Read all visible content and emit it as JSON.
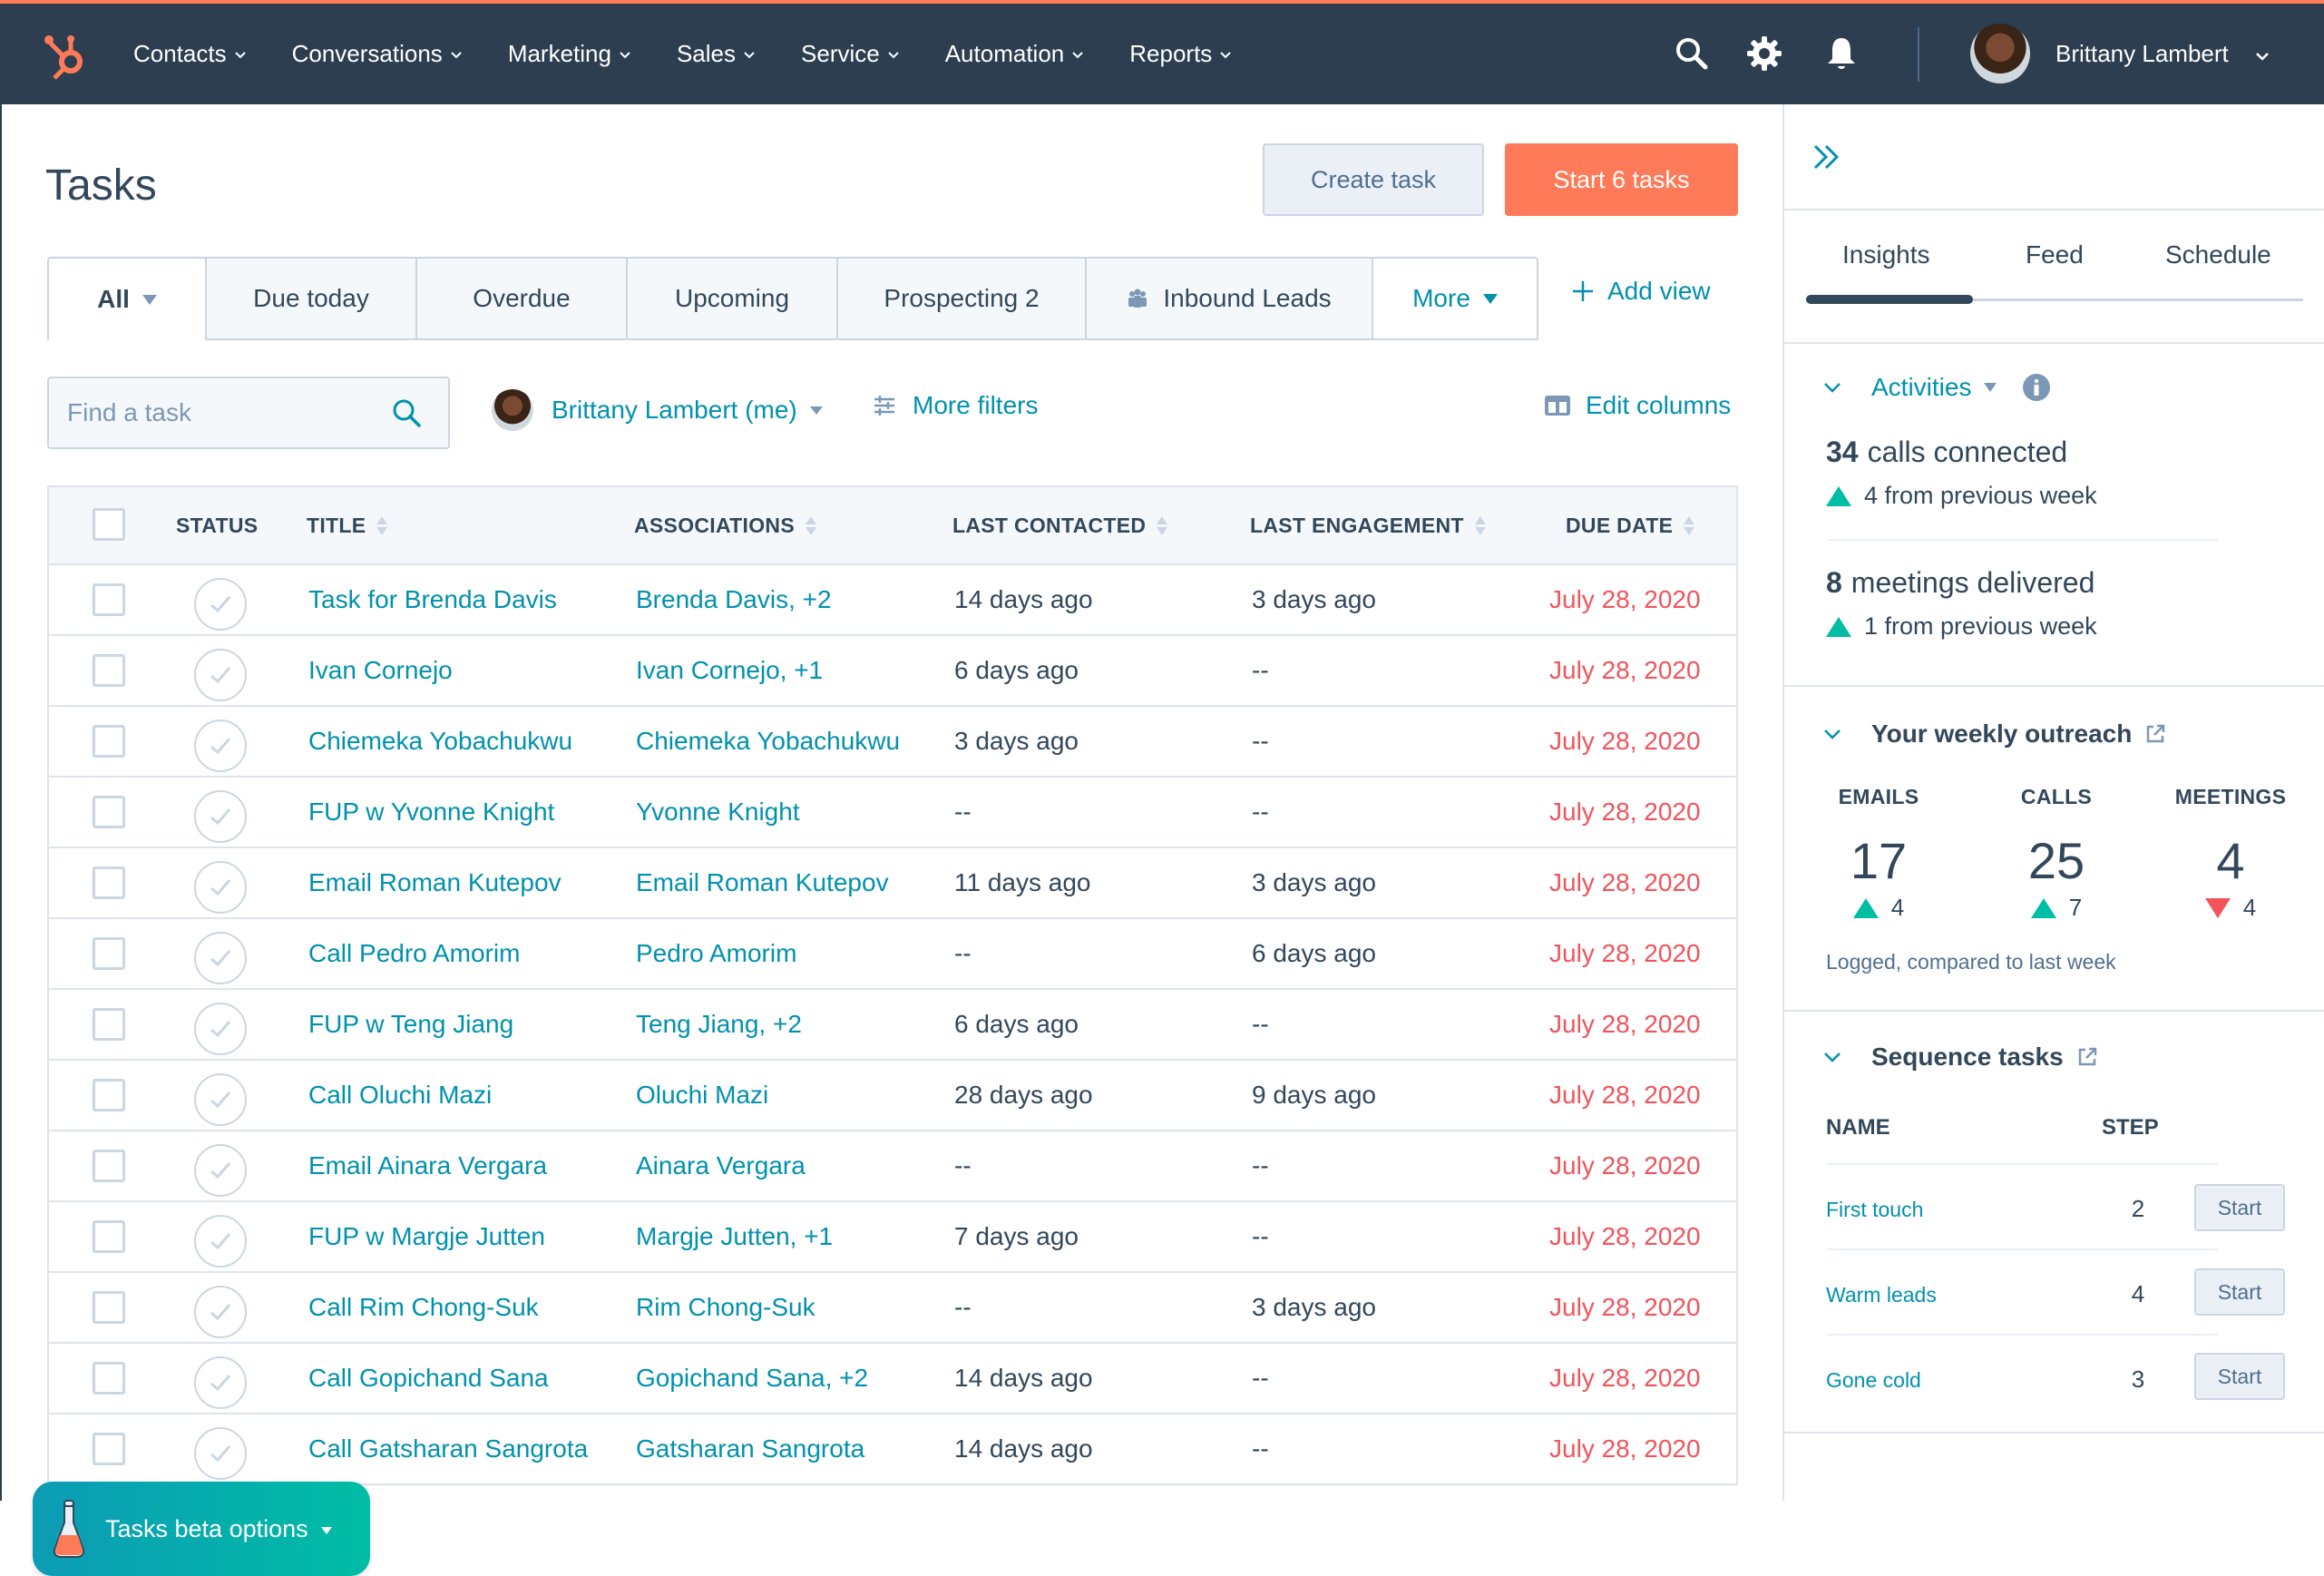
{
  "colors": {
    "nav_bg": "#2d3e50",
    "brand_orange": "#ff7a59",
    "link_teal": "#0091ae",
    "overdue_red": "#f2545b",
    "up_green": "#00bda5",
    "text": "#33475b"
  },
  "topnav": {
    "logo": "hubspot-sprocket-icon",
    "items": [
      {
        "label": "Contacts"
      },
      {
        "label": "Conversations"
      },
      {
        "label": "Marketing"
      },
      {
        "label": "Sales"
      },
      {
        "label": "Service"
      },
      {
        "label": "Automation"
      },
      {
        "label": "Reports"
      }
    ],
    "icons": [
      "search-icon",
      "gear-icon",
      "bell-icon"
    ],
    "user_name": "Brittany Lambert"
  },
  "page": {
    "title": "Tasks",
    "create_button": "Create task",
    "start_button": "Start 6 tasks"
  },
  "views": {
    "tabs": [
      {
        "label": "All",
        "active": true
      },
      {
        "label": "Due today"
      },
      {
        "label": "Overdue"
      },
      {
        "label": "Upcoming"
      },
      {
        "label": "Prospecting 2"
      },
      {
        "label": "Inbound Leads",
        "icon": "team-icon"
      },
      {
        "label": "More"
      }
    ],
    "add_view": "Add view"
  },
  "filters": {
    "search_placeholder": "Find a task",
    "search_value": "",
    "owner": "Brittany Lambert (me)",
    "more_filters": "More filters",
    "edit_columns": "Edit columns"
  },
  "table": {
    "columns": [
      "STATUS",
      "TITLE",
      "ASSOCIATIONS",
      "LAST CONTACTED",
      "LAST ENGAGEMENT",
      "DUE DATE"
    ],
    "rows": [
      {
        "title": "Task for Brenda Davis",
        "associations": "Brenda Davis, +2",
        "last_contacted": "14 days ago",
        "last_engagement": "3 days ago",
        "due": "July 28, 2020"
      },
      {
        "title": "Ivan Cornejo",
        "associations": "Ivan Cornejo, +1",
        "last_contacted": "6 days ago",
        "last_engagement": "--",
        "due": "July 28, 2020"
      },
      {
        "title": "Chiemeka Yobachukwu",
        "associations": "Chiemeka Yobachukwu",
        "last_contacted": "3 days ago",
        "last_engagement": "--",
        "due": "July 28, 2020"
      },
      {
        "title": "FUP w Yvonne Knight",
        "associations": "Yvonne Knight",
        "last_contacted": "--",
        "last_engagement": "--",
        "due": "July 28, 2020"
      },
      {
        "title": "Email Roman Kutepov",
        "associations": "Email Roman Kutepov",
        "last_contacted": "11 days ago",
        "last_engagement": "3 days ago",
        "due": "July 28, 2020"
      },
      {
        "title": "Call Pedro Amorim",
        "associations": "Pedro Amorim",
        "last_contacted": "--",
        "last_engagement": "6 days ago",
        "due": "July 28, 2020"
      },
      {
        "title": "FUP w Teng Jiang",
        "associations": "Teng Jiang, +2",
        "last_contacted": "6 days ago",
        "last_engagement": "--",
        "due": "July 28, 2020"
      },
      {
        "title": "Call Oluchi Mazi",
        "associations": "Oluchi Mazi",
        "last_contacted": "28 days ago",
        "last_engagement": "9 days ago",
        "due": "July 28, 2020"
      },
      {
        "title": "Email Ainara Vergara",
        "associations": "Ainara Vergara",
        "last_contacted": "--",
        "last_engagement": "--",
        "due": "July 28, 2020"
      },
      {
        "title": "FUP w Margje Jutten",
        "associations": "Margje Jutten, +1",
        "last_contacted": "7 days ago",
        "last_engagement": "--",
        "due": "July 28, 2020"
      },
      {
        "title": "Call Rim Chong-Suk",
        "associations": "Rim Chong-Suk",
        "last_contacted": "--",
        "last_engagement": "3 days ago",
        "due": "July 28, 2020"
      },
      {
        "title": "Call Gopichand Sana",
        "associations": "Gopichand Sana, +2",
        "last_contacted": "14 days ago",
        "last_engagement": "--",
        "due": "July 28, 2020"
      },
      {
        "title": "Call Gatsharan Sangrota",
        "associations": "Gatsharan Sangrota",
        "last_contacted": "14 days ago",
        "last_engagement": "--",
        "due": "July 28, 2020"
      }
    ]
  },
  "beta": {
    "label": "Tasks beta options",
    "icon": "flask-icon"
  },
  "sidebar": {
    "tabs": [
      {
        "label": "Insights",
        "active": true
      },
      {
        "label": "Feed"
      },
      {
        "label": "Schedule"
      }
    ],
    "activities": {
      "title": "Activities",
      "stats": [
        {
          "value": "34",
          "label": "calls connected",
          "delta": "4 from previous week",
          "direction": "up"
        },
        {
          "value": "8",
          "label": "meetings delivered",
          "delta": "1 from previous week",
          "direction": "up"
        }
      ]
    },
    "outreach": {
      "title": "Your weekly outreach",
      "columns": [
        {
          "label": "EMAILS",
          "value": "17",
          "delta": "4",
          "direction": "up"
        },
        {
          "label": "CALLS",
          "value": "25",
          "delta": "7",
          "direction": "up"
        },
        {
          "label": "MEETINGS",
          "value": "4",
          "delta": "4",
          "direction": "down"
        }
      ],
      "footnote": "Logged, compared to last week"
    },
    "sequences": {
      "title": "Sequence tasks",
      "name_header": "NAME",
      "step_header": "STEP",
      "items": [
        {
          "name": "First touch",
          "step": "2",
          "action": "Start"
        },
        {
          "name": "Warm leads",
          "step": "4",
          "action": "Start"
        },
        {
          "name": "Gone cold",
          "step": "3",
          "action": "Start"
        }
      ]
    }
  }
}
